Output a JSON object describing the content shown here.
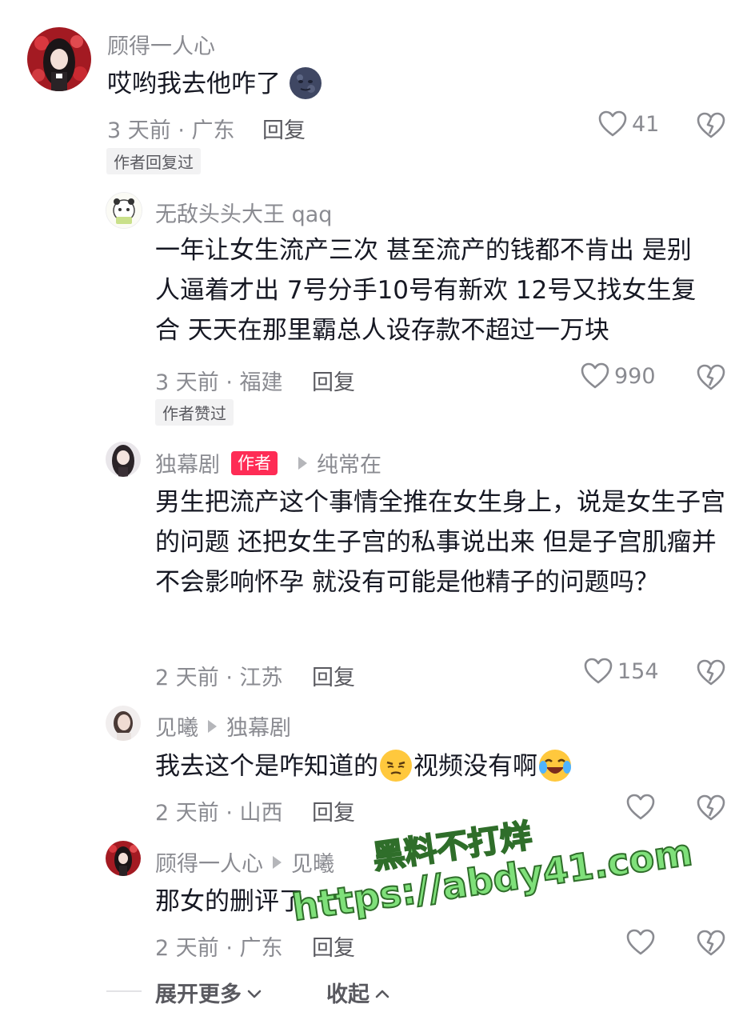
{
  "comments": [
    {
      "username": "顾得一人心",
      "text": "哎哟我去他咋了",
      "emoji": "new-moon-face-emoji",
      "time_location": "3 天前 · 广东",
      "reply_label": "回复",
      "likes": "41",
      "tag": "作者回复过"
    },
    {
      "username": "无敌头头大王 qaq",
      "text": "一年让女生流产三次  甚至流产的钱都不肯出 是别人逼着才出 7号分手10号有新欢 12号又找女生复合 天天在那里霸总人设存款不超过一万块",
      "time_location": "3 天前 · 福建",
      "reply_label": "回复",
      "likes": "990",
      "tag": "作者赞过"
    },
    {
      "username": "独幕剧",
      "author_badge": "作者",
      "reply_to": "纯常在",
      "text": "男生把流产这个事情全推在女生身上，说是女生子宫的问题 还把女生子宫的私事说出来 但是子宫肌瘤并不会影响怀孕 就没有可能是他精子的问题吗？",
      "time_location": "2 天前 · 江苏",
      "reply_label": "回复",
      "likes": "154"
    },
    {
      "username": "见曦",
      "reply_to": "独幕剧",
      "text_before": "我去这个是咋知道的",
      "text_middle": "视频没有啊",
      "time_location": "2 天前 · 山西",
      "reply_label": "回复"
    },
    {
      "username": "顾得一人心",
      "reply_to": "见曦",
      "text": "那女的删评了",
      "time_location": "2 天前 · 广东",
      "reply_label": "回复"
    }
  ],
  "footer": {
    "expand_label": "展开更多",
    "collapse_label": "收起"
  },
  "watermark": {
    "line1": "黑料不打烊",
    "line2": "https://abdy41.com"
  },
  "colors": {
    "text": "#161823",
    "secondary": "#8a8b91",
    "author_badge": "#fe2c55",
    "watermark": "#7fe07a"
  }
}
